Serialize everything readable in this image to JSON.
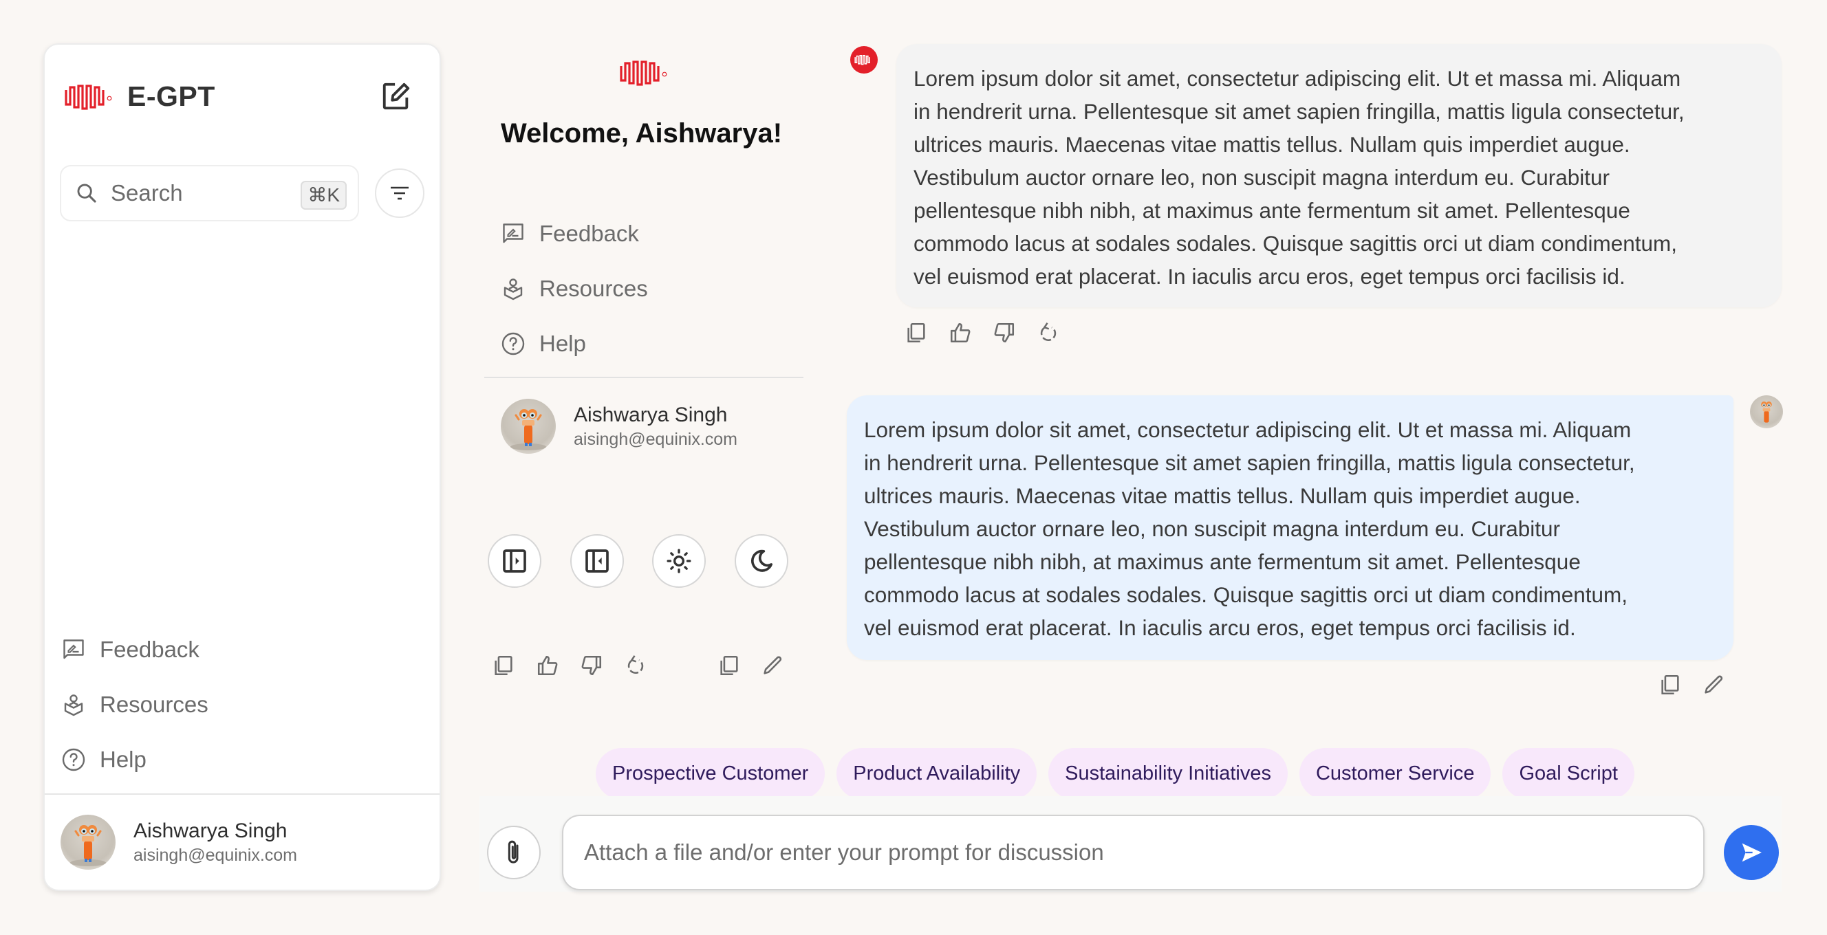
{
  "app": {
    "title": "E-GPT",
    "brand_color": "#e3202a",
    "accent_color": "#2f6fef"
  },
  "sidebar": {
    "search": {
      "placeholder": "Search",
      "value": "",
      "shortcut": "⌘K"
    },
    "nav_items": [
      {
        "label": "Feedback",
        "icon": "feedback-icon"
      },
      {
        "label": "Resources",
        "icon": "resources-icon"
      },
      {
        "label": "Help",
        "icon": "help-icon"
      }
    ],
    "user": {
      "name": "Aishwarya Singh",
      "email": "aisingh@equinix.com"
    }
  },
  "panel": {
    "welcome": "Welcome, Aishwarya!",
    "nav_items": [
      {
        "label": "Feedback",
        "icon": "feedback-icon"
      },
      {
        "label": "Resources",
        "icon": "resources-icon"
      },
      {
        "label": "Help",
        "icon": "help-icon"
      }
    ],
    "user": {
      "name": "Aishwarya Singh",
      "email": "aisingh@equinix.com"
    },
    "round_buttons": [
      "expand-sidebar",
      "collapse-sidebar",
      "light-mode",
      "dark-mode"
    ],
    "action_icons": [
      "copy",
      "thumbs-up",
      "thumbs-down",
      "regenerate",
      "copy",
      "edit"
    ]
  },
  "chat": {
    "messages": [
      {
        "role": "assistant",
        "lines": [
          "Lorem ipsum dolor sit amet, consectetur adipiscing elit. Ut et massa mi. Aliquam",
          "in hendrerit urna. Pellentesque sit amet sapien fringilla, mattis ligula consectetur,",
          "ultrices mauris. Maecenas vitae mattis tellus. Nullam quis imperdiet augue.",
          "Vestibulum auctor ornare leo, non suscipit magna interdum eu. Curabitur",
          "pellentesque nibh nibh, at maximus ante fermentum sit amet. Pellentesque",
          "commodo lacus at sodales sodales. Quisque sagittis orci ut diam condimentum,",
          "vel euismod erat placerat. In iaculis arcu eros, eget tempus orci facilisis id."
        ],
        "actions": [
          "copy",
          "thumbs-up",
          "thumbs-down",
          "regenerate"
        ]
      },
      {
        "role": "user",
        "lines": [
          "Lorem ipsum dolor sit amet, consectetur adipiscing elit. Ut et massa mi. Aliquam",
          "in hendrerit urna. Pellentesque sit amet sapien fringilla, mattis ligula consectetur,",
          "ultrices mauris. Maecenas vitae mattis tellus. Nullam quis imperdiet augue.",
          "Vestibulum auctor ornare leo, non suscipit magna interdum eu. Curabitur",
          "pellentesque nibh nibh, at maximus ante fermentum sit amet. Pellentesque",
          "commodo lacus at sodales sodales. Quisque sagittis orci ut diam condimentum,",
          "vel euismod erat placerat. In iaculis arcu eros, eget tempus orci facilisis id."
        ],
        "actions": [
          "copy",
          "edit"
        ]
      }
    ],
    "suggestions": [
      "Prospective Customer",
      "Product Availability",
      "Sustainability Initiatives",
      "Customer Service",
      "Goal Script"
    ],
    "input": {
      "placeholder": "Attach a file and/or enter your prompt for discussion",
      "value": ""
    }
  }
}
